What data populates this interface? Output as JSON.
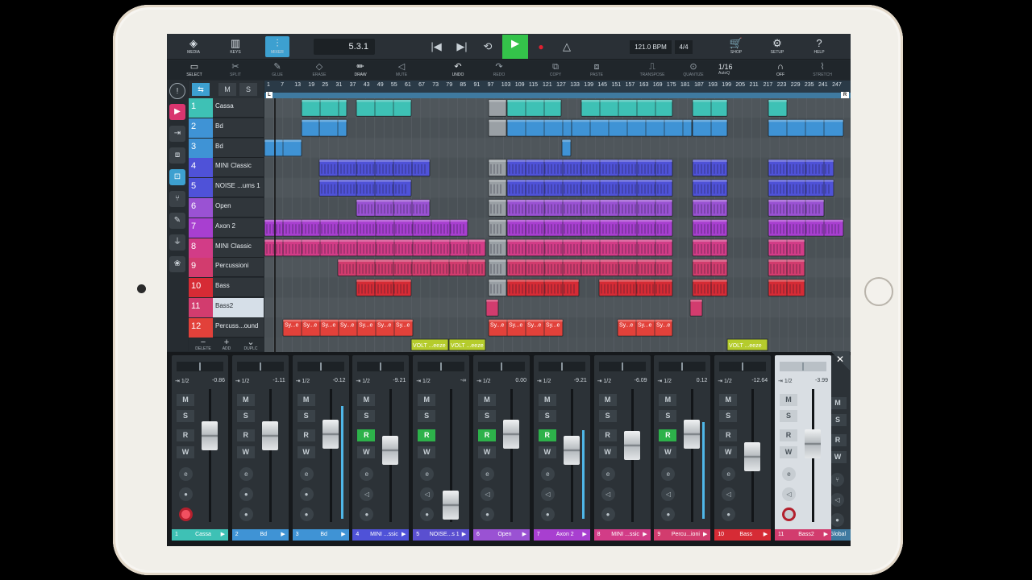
{
  "toolbar": {
    "media": "MEDIA",
    "keys": "KEYS",
    "mixer": "MIXER",
    "position": "5.3.1",
    "tempo": "121.0 BPM",
    "signature": "4/4",
    "shop": "SHOP",
    "setup": "SETUP",
    "help": "HELP"
  },
  "tools": {
    "select": "SELECT",
    "split": "SPLIT",
    "glue": "GLUE",
    "erase": "ERASE",
    "draw": "DRAW",
    "mute": "MUTE",
    "undo": "UNDO",
    "redo": "REDO",
    "copy": "COPY",
    "paste": "PASTE",
    "transpose": "TRANSPOSE",
    "quantize": "QUANTIZE",
    "quantize_value": "1/16",
    "quantize_mode": "AutoQ",
    "snap_state": "OFF",
    "snap_label": "STRETCH"
  },
  "track_header": {
    "m": "M",
    "s": "S",
    "delete": "DELETE",
    "add": "ADD",
    "duplicate": "DUPLC"
  },
  "ruler": {
    "ticks": [
      "1",
      "7",
      "13",
      "19",
      "25",
      "31",
      "37",
      "43",
      "49",
      "55",
      "61",
      "67",
      "73",
      "79",
      "85",
      "91",
      "97",
      "103",
      "109",
      "115",
      "121",
      "127",
      "133",
      "139",
      "145",
      "151",
      "157",
      "163",
      "169",
      "175",
      "181",
      "187",
      "193",
      "199",
      "205",
      "211",
      "217",
      "223",
      "229",
      "235",
      "241",
      "247"
    ],
    "left_locator": "L",
    "right_locator": "R"
  },
  "tracks": [
    {
      "num": "1",
      "name": "Cassa",
      "color": "#3ec1b5"
    },
    {
      "num": "2",
      "name": "Bd",
      "color": "#3f93d5"
    },
    {
      "num": "3",
      "name": "Bd",
      "color": "#3f93d5"
    },
    {
      "num": "4",
      "name": "MINI Classic",
      "color": "#4f52d8"
    },
    {
      "num": "5",
      "name": "NOISE ...ums 1",
      "color": "#4f52d8"
    },
    {
      "num": "6",
      "name": "Open",
      "color": "#9a52d3"
    },
    {
      "num": "7",
      "name": "Axon 2",
      "color": "#a83fd0"
    },
    {
      "num": "8",
      "name": "MINI Classic",
      "color": "#d23c87"
    },
    {
      "num": "9",
      "name": "Percussioni",
      "color": "#d23c6e"
    },
    {
      "num": "10",
      "name": "Bass",
      "color": "#d62b35"
    },
    {
      "num": "11",
      "name": "Bass2",
      "color": "#d23c6e"
    },
    {
      "num": "12",
      "name": "Percuss...ound",
      "color": "#e2413a"
    }
  ],
  "clip_labels": {
    "sy": "Sy...e",
    "volt": "VOLT ...eeze"
  },
  "mixer": {
    "io_label": "1/2",
    "button_m": "M",
    "button_s": "S",
    "button_r": "R",
    "button_w": "W",
    "channels": [
      {
        "index": "1",
        "name": "Cassa",
        "volume": "-0.86",
        "color": "#3ec1b5",
        "r_active": false
      },
      {
        "index": "2",
        "name": "Bd",
        "volume": "-1.11",
        "color": "#3f93d5",
        "r_active": false
      },
      {
        "index": "3",
        "name": "Bd",
        "volume": "-0.12",
        "color": "#3f93d5",
        "r_active": false
      },
      {
        "index": "4",
        "name": "MINI ...ssic",
        "volume": "-9.21",
        "color": "#4f52d8",
        "r_active": true
      },
      {
        "index": "5",
        "name": "NOISE...s 1",
        "volume": "-∞",
        "color": "#5a4fd0",
        "r_active": true
      },
      {
        "index": "6",
        "name": "Open",
        "volume": "0.00",
        "color": "#9a52d3",
        "r_active": true
      },
      {
        "index": "7",
        "name": "Axon 2",
        "volume": "-9.21",
        "color": "#a83fd0",
        "r_active": true
      },
      {
        "index": "8",
        "name": "MINI ...ssic",
        "volume": "-6.09",
        "color": "#d23c87",
        "r_active": false
      },
      {
        "index": "9",
        "name": "Percu...ioni",
        "volume": "0.12",
        "color": "#d23c6e",
        "r_active": true
      },
      {
        "index": "10",
        "name": "Bass",
        "volume": "-12.64",
        "color": "#d62b35",
        "r_active": false
      },
      {
        "index": "11",
        "name": "Bass2",
        "volume": "-3.99",
        "color": "#d23c6e",
        "r_active": false
      }
    ],
    "global_label": "Global"
  }
}
